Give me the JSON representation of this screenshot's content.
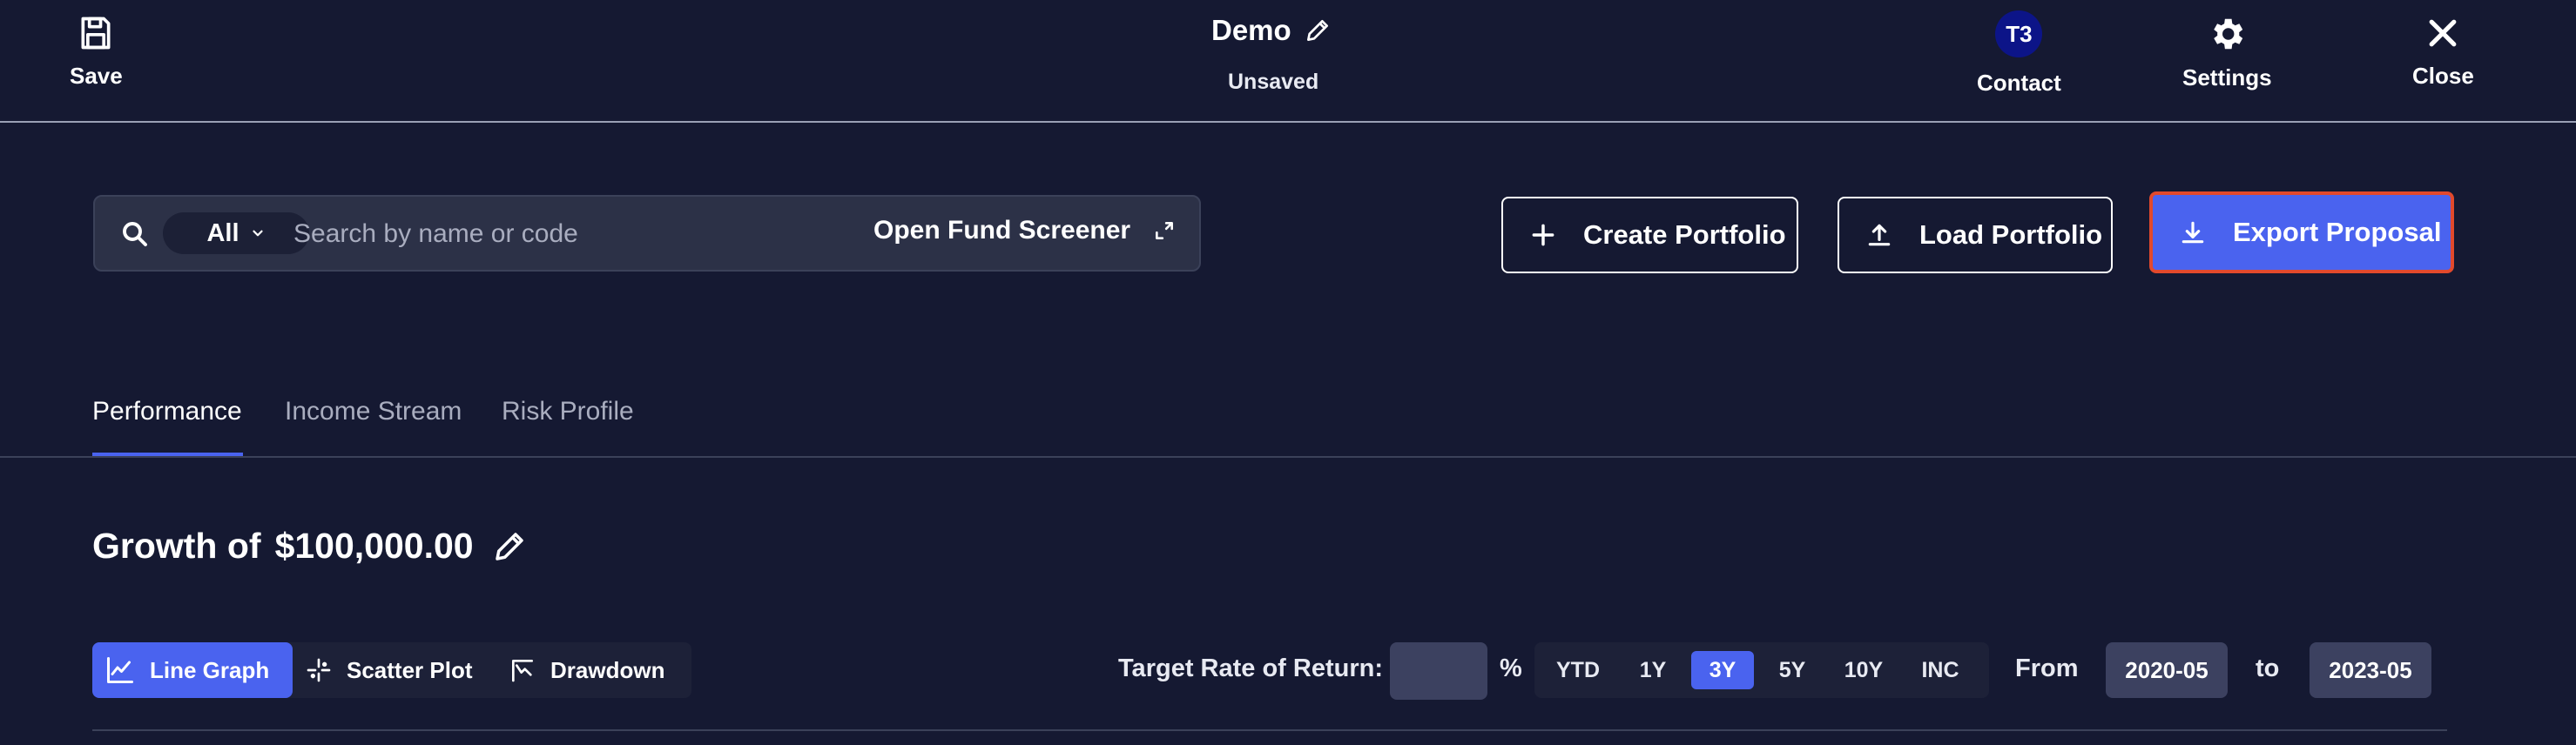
{
  "topbar": {
    "save_label": "Save",
    "document_name": "Demo",
    "document_status": "Unsaved",
    "contact_label": "Contact",
    "contact_initials": "T3",
    "settings_label": "Settings",
    "close_label": "Close"
  },
  "search": {
    "filter_value": "All",
    "placeholder": "Search by name or code",
    "screener_label": "Open Fund Screener"
  },
  "actions": {
    "create_label": "Create Portfolio",
    "load_label": "Load Portfolio",
    "export_label": "Export Proposal"
  },
  "tabs": [
    {
      "label": "Performance",
      "active": true
    },
    {
      "label": "Income Stream",
      "active": false
    },
    {
      "label": "Risk Profile",
      "active": false
    }
  ],
  "growth": {
    "prefix": "Growth of",
    "amount": "$100,000.00"
  },
  "chart_types": [
    {
      "label": "Line Graph",
      "icon": "line-graph-icon",
      "active": true
    },
    {
      "label": "Scatter Plot",
      "icon": "scatter-plot-icon",
      "active": false
    },
    {
      "label": "Drawdown",
      "icon": "drawdown-icon",
      "active": false
    }
  ],
  "target_return": {
    "label": "Target Rate of Return:",
    "value": "",
    "unit": "%"
  },
  "periods": [
    "YTD",
    "1Y",
    "3Y",
    "5Y",
    "10Y",
    "INC"
  ],
  "selected_period": "3Y",
  "date_range": {
    "from_label": "From",
    "from_value": "2020-05",
    "to_label": "to",
    "to_value": "2023-05"
  },
  "colors": {
    "background": "#151932",
    "accent": "#4a63ef",
    "highlight_outline": "#e2492c",
    "avatar": "#0c1488"
  }
}
